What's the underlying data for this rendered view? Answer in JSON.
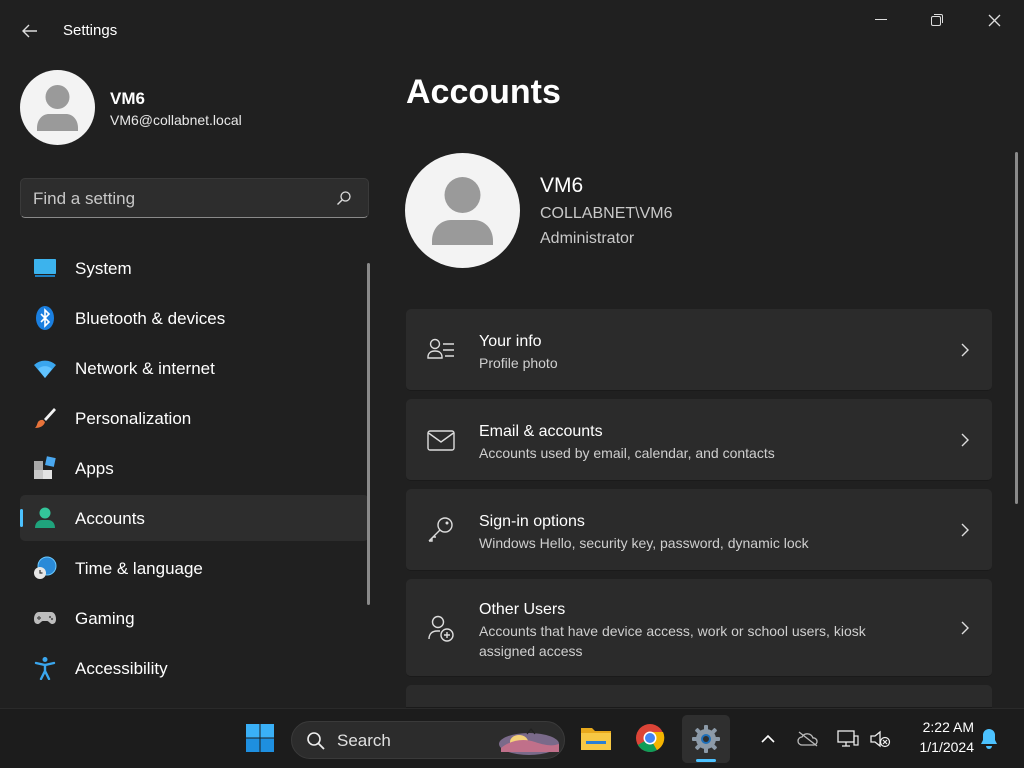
{
  "window": {
    "title": "Settings",
    "back_icon": "back-arrow-icon",
    "minimize_icon": "minimize-icon",
    "maximize_icon": "restore-icon",
    "close_icon": "close-icon"
  },
  "user": {
    "name": "VM6",
    "email": "VM6@collabnet.local"
  },
  "search": {
    "placeholder": "Find a setting",
    "icon": "search-icon"
  },
  "sidebar": {
    "items": [
      {
        "label": "System",
        "icon": "system-icon",
        "active": false
      },
      {
        "label": "Bluetooth & devices",
        "icon": "bluetooth-icon",
        "active": false
      },
      {
        "label": "Network & internet",
        "icon": "wifi-icon",
        "active": false
      },
      {
        "label": "Personalization",
        "icon": "brush-icon",
        "active": false
      },
      {
        "label": "Apps",
        "icon": "apps-icon",
        "active": false
      },
      {
        "label": "Accounts",
        "icon": "accounts-icon",
        "active": true
      },
      {
        "label": "Time & language",
        "icon": "globe-clock-icon",
        "active": false
      },
      {
        "label": "Gaming",
        "icon": "gamepad-icon",
        "active": false
      },
      {
        "label": "Accessibility",
        "icon": "accessibility-icon",
        "active": false
      }
    ]
  },
  "main": {
    "title": "Accounts",
    "profile": {
      "name": "VM6",
      "domain": "COLLABNET\\VM6",
      "role": "Administrator"
    },
    "cards": [
      {
        "title": "Your info",
        "subtitle": "Profile photo",
        "icon": "person-details-icon"
      },
      {
        "title": "Email & accounts",
        "subtitle": "Accounts used by email, calendar, and contacts",
        "icon": "mail-icon"
      },
      {
        "title": "Sign-in options",
        "subtitle": "Windows Hello, security key, password, dynamic lock",
        "icon": "key-icon"
      },
      {
        "title": "Other Users",
        "subtitle": "Accounts that have device access, work or school users, kiosk assigned access",
        "icon": "person-add-icon"
      }
    ]
  },
  "taskbar": {
    "search_label": "Search",
    "time": "2:22 AM",
    "date": "1/1/2024",
    "apps": [
      "start-icon",
      "file-explorer-icon",
      "chrome-icon",
      "settings-icon"
    ],
    "tray": [
      "chevron-up-icon",
      "onedrive-offline-icon",
      "network-icon",
      "volume-muted-icon",
      "notification-bell-icon"
    ]
  },
  "colors": {
    "accent": "#4cc2ff",
    "background": "#202020",
    "card": "#2b2b2b"
  }
}
